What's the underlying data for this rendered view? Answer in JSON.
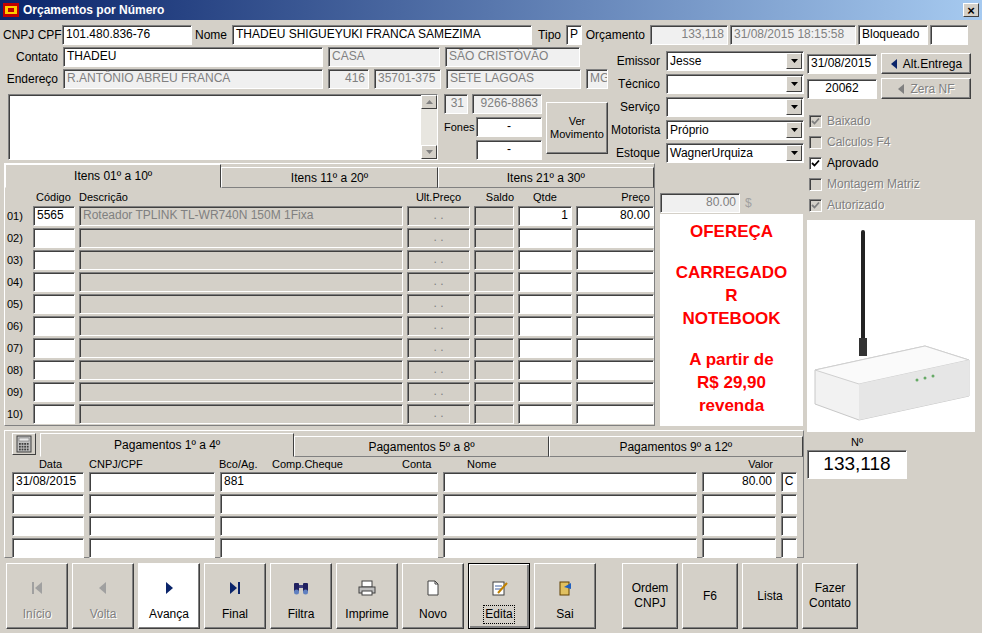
{
  "window": {
    "title": "Orçamentos por Número",
    "close": "×"
  },
  "header": {
    "cnpj_label": "CNPJ CPF",
    "cnpj": {
      "value": "101.480.836-76",
      "disabled": false
    },
    "name_label": "Nome",
    "name": {
      "value": "THADEU SHIGUEYUKI FRANCA SAMEZIMA",
      "disabled": false
    },
    "type_label": "Tipo",
    "type": {
      "value": "P",
      "disabled": false
    },
    "quote_label": "Orçamento",
    "quote_number": {
      "value": "133,118",
      "disabled": true
    },
    "quote_datetime": {
      "value": "31/08/2015 18:15:58",
      "disabled": true
    },
    "quote_status": {
      "value": "Bloqueado",
      "disabled": false
    },
    "quote_extra": {
      "value": "",
      "disabled": false
    }
  },
  "customer": {
    "contact_label": "Contato",
    "contact": {
      "value": "THADEU",
      "disabled": false
    },
    "complement": {
      "value": "CASA",
      "disabled": true
    },
    "district": {
      "value": "SÃO CRISTÓVÃO",
      "disabled": true
    },
    "address_label": "Endereço",
    "address": {
      "value": "R.ANTÔNIO ABREU FRANCA",
      "disabled": true
    },
    "number": {
      "value": "416",
      "disabled": true
    },
    "zip": {
      "value": "35701-375",
      "disabled": true
    },
    "city": {
      "value": "SETE LAGOAS",
      "disabled": true
    },
    "state": {
      "value": "MG",
      "disabled": true
    },
    "notes": {
      "value": "",
      "disabled": false
    },
    "ddd": {
      "value": "31",
      "disabled": true
    },
    "phone": {
      "value": "9266-8863",
      "disabled": true
    },
    "phones_label": "Fones",
    "phone2": {
      "value": "-",
      "disabled": false
    },
    "phone3": {
      "value": "-",
      "disabled": false
    }
  },
  "movement_button": {
    "label": "Ver Movimento",
    "disabled": false
  },
  "selects": [
    {
      "label": "Emissor",
      "value": "Jesse"
    },
    {
      "label": "Técnico",
      "value": ""
    },
    {
      "label": "Serviço",
      "value": ""
    },
    {
      "label": "Motorista",
      "value": "Próprio"
    },
    {
      "label": "Estoque",
      "value": "WagnerUrquiza"
    }
  ],
  "delivery": {
    "date": {
      "value": "31/08/2015",
      "disabled": false
    },
    "button": "Alt.Entrega",
    "disabled": false
  },
  "nf": {
    "value": {
      "value": "20062",
      "disabled": false
    },
    "button": "Zera NF",
    "disabled": true
  },
  "checkboxes": [
    {
      "label": "Baixado",
      "checked": true,
      "disabled": true
    },
    {
      "label": "Calculos F4",
      "checked": false,
      "disabled": true
    },
    {
      "label": "Aprovado",
      "checked": true,
      "disabled": false
    },
    {
      "label": "Montagem Matriz",
      "checked": false,
      "disabled": true
    },
    {
      "label": "Autorizado",
      "checked": true,
      "disabled": true
    }
  ],
  "items": {
    "tabs": [
      {
        "label": "Itens 01º a 10º",
        "selected": true
      },
      {
        "label": "Itens 11º a 20º",
        "selected": false
      },
      {
        "label": "Itens 21º a 30º",
        "selected": false
      }
    ],
    "columns": [
      "Código",
      "Descrição",
      "Ult.Preço",
      "Saldo",
      "Qtde",
      "Preço"
    ],
    "rows": [
      {
        "index": "01)",
        "code": "5565",
        "description": "Roteador TPLINK TL-WR740N 150M 1Fixa",
        "last_price": ". .",
        "balance": "",
        "qty": "1",
        "price": "80.00"
      },
      {
        "index": "02)",
        "code": "",
        "description": "",
        "last_price": ". .",
        "balance": "",
        "qty": "",
        "price": ""
      },
      {
        "index": "03)",
        "code": "",
        "description": "",
        "last_price": ". .",
        "balance": "",
        "qty": "",
        "price": ""
      },
      {
        "index": "04)",
        "code": "",
        "description": "",
        "last_price": ". .",
        "balance": "",
        "qty": "",
        "price": ""
      },
      {
        "index": "05)",
        "code": "",
        "description": "",
        "last_price": ". .",
        "balance": "",
        "qty": "",
        "price": ""
      },
      {
        "index": "06)",
        "code": "",
        "description": "",
        "last_price": ". .",
        "balance": "",
        "qty": "",
        "price": ""
      },
      {
        "index": "07)",
        "code": "",
        "description": "",
        "last_price": ". .",
        "balance": "",
        "qty": "",
        "price": ""
      },
      {
        "index": "08)",
        "code": "",
        "description": "",
        "last_price": ". .",
        "balance": "",
        "qty": "",
        "price": ""
      },
      {
        "index": "09)",
        "code": "",
        "description": "",
        "last_price": ". .",
        "balance": "",
        "qty": "",
        "price": ""
      },
      {
        "index": "10)",
        "code": "",
        "description": "",
        "last_price": ". .",
        "balance": "",
        "qty": "",
        "price": ""
      }
    ]
  },
  "total": {
    "value": "80.00",
    "currency": "$"
  },
  "promo": {
    "groups": [
      [
        "OFEREÇA"
      ],
      [
        "CARREGADO",
        "R",
        "NOTEBOOK"
      ],
      [
        "A partir de",
        "R$ 29,90",
        "revenda"
      ]
    ]
  },
  "payments": {
    "tabs": [
      {
        "label": "Pagamentos 1º a 4º",
        "selected": true
      },
      {
        "label": "Pagamentos 5º a 8º",
        "selected": false
      },
      {
        "label": "Pagamentos 9º a 12º",
        "selected": false
      }
    ],
    "columns": [
      "Data",
      "CNPJ/CPF",
      "Bco/Ag.",
      "Comp.Cheque",
      "Conta",
      "Nome",
      "Valor"
    ],
    "rows": [
      {
        "date": "31/08/2015",
        "doc": "",
        "bank": "881",
        "name": "",
        "value": "80.00",
        "type": "C"
      },
      {
        "date": "",
        "doc": "",
        "bank": "",
        "name": "",
        "value": "",
        "type": ""
      },
      {
        "date": "",
        "doc": "",
        "bank": "",
        "name": "",
        "value": "",
        "type": ""
      },
      {
        "date": "",
        "doc": "",
        "bank": "",
        "name": "",
        "value": "",
        "type": ""
      }
    ]
  },
  "number": {
    "label": "Nº",
    "value": "133,118"
  },
  "toolbar": [
    {
      "label": "Início",
      "kind": "first",
      "disabled": true,
      "hover": false,
      "focused": false
    },
    {
      "label": "Volta",
      "kind": "prev",
      "disabled": true,
      "hover": false,
      "focused": false
    },
    {
      "label": "Avança",
      "kind": "next",
      "disabled": false,
      "hover": true,
      "focused": false
    },
    {
      "label": "Final",
      "kind": "last",
      "disabled": false,
      "hover": false,
      "focused": false
    },
    {
      "label": "Filtra",
      "kind": "filter",
      "disabled": false,
      "hover": false,
      "focused": false
    },
    {
      "label": "Imprime",
      "kind": "print",
      "disabled": false,
      "hover": false,
      "focused": false
    },
    {
      "label": "Novo",
      "kind": "new",
      "disabled": false,
      "hover": false,
      "focused": false
    },
    {
      "label": "Edita",
      "kind": "edit",
      "disabled": false,
      "hover": false,
      "focused": true
    },
    {
      "label": "Sai",
      "kind": "exit",
      "disabled": false,
      "hover": false,
      "focused": false
    },
    {
      "label": "Ordem CNPJ",
      "kind": "text",
      "disabled": false,
      "hover": false,
      "focused": false
    },
    {
      "label": "F6",
      "kind": "text",
      "disabled": false,
      "hover": false,
      "focused": false
    },
    {
      "label": "Lista",
      "kind": "text",
      "disabled": false,
      "hover": false,
      "focused": false
    },
    {
      "label": "Fazer Contato",
      "kind": "text",
      "disabled": false,
      "hover": false,
      "focused": false
    }
  ]
}
